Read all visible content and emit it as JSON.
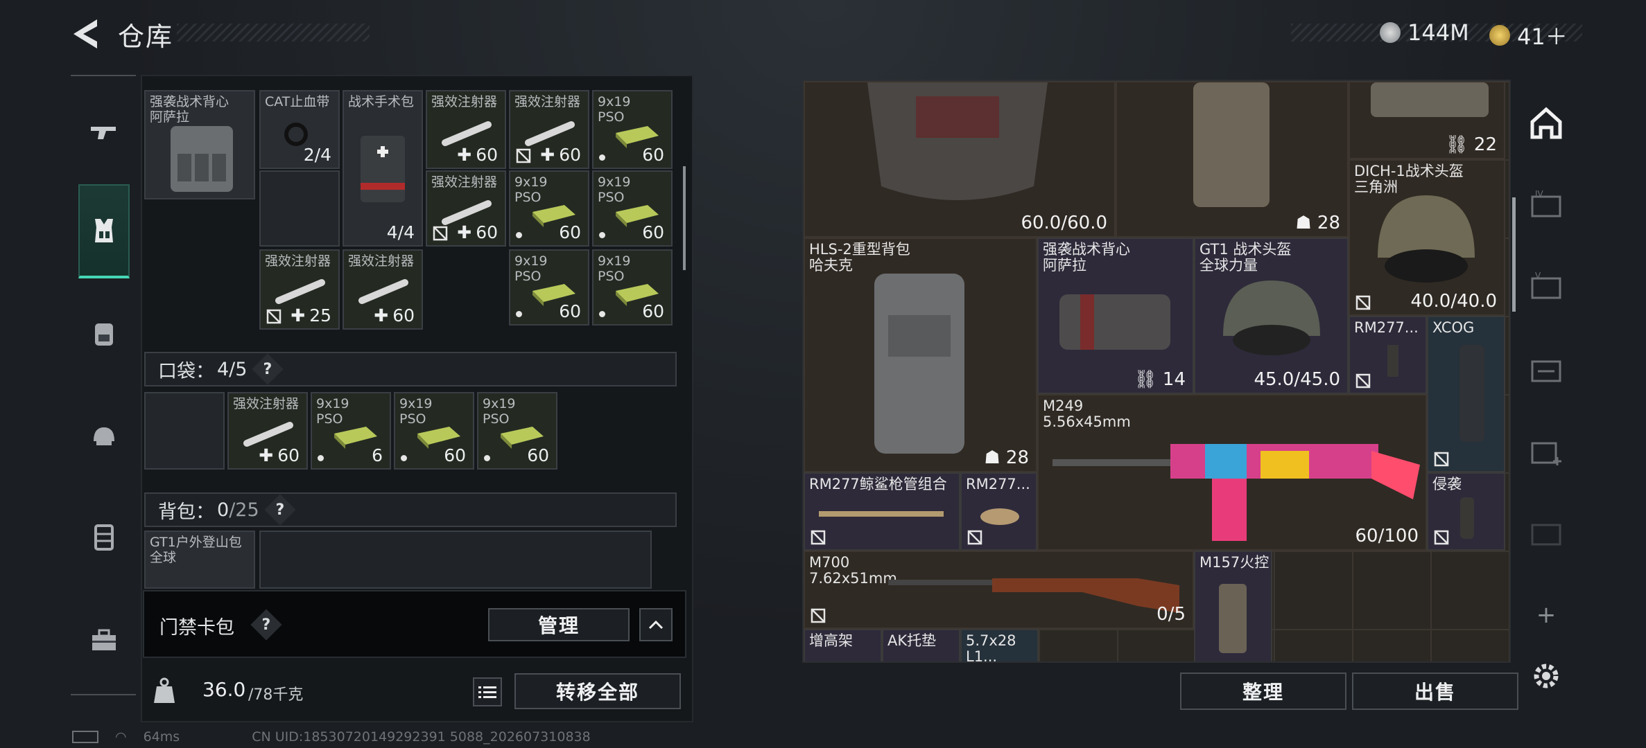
{
  "header": {
    "title": "仓库"
  },
  "currency": {
    "silver": {
      "value": "144M",
      "icon": "silver-coin-icon"
    },
    "gold": {
      "value": "41＋",
      "icon": "gold-coin-icon"
    }
  },
  "left_nav": [
    "weapon-icon",
    "equipment-icon",
    "backpack-icon",
    "helmet-icon",
    "chest-rig-icon",
    "toolbox-icon"
  ],
  "vest_grid": {
    "vest": {
      "label": "强袭战术背心\n阿萨拉"
    },
    "items": [
      {
        "label": "CAT止血带",
        "count": "2/4"
      },
      {
        "label": "战术手术包",
        "count": "4/4"
      },
      {
        "label": "强效注射器",
        "count": "60"
      },
      {
        "label": "强效注射器",
        "count": "60"
      },
      {
        "label": "9x19\nPSO",
        "count": "60"
      },
      {
        "label": "强效注射器",
        "count": "60"
      },
      {
        "label": "9x19\nPSO",
        "count": "60"
      },
      {
        "label": "9x19\nPSO",
        "count": "60"
      },
      {
        "label": "强效注射器",
        "count": "25"
      },
      {
        "label": "强效注射器",
        "count": "60"
      },
      {
        "label": "9x19\nPSO",
        "count": "60"
      },
      {
        "label": "9x19\nPSO",
        "count": "60"
      }
    ]
  },
  "pocket": {
    "label": "口袋：",
    "value": "4/5",
    "help": "?",
    "items": [
      {
        "label": "强效注射器",
        "count": "60"
      },
      {
        "label": "9x19\nPSO",
        "count": "6"
      },
      {
        "label": "9x19\nPSO",
        "count": "60"
      },
      {
        "label": "9x19\nPSO",
        "count": "60"
      }
    ]
  },
  "backpack": {
    "label": "背包：",
    "value_main": "0",
    "value_cap": "/25",
    "help": "?",
    "item_label": "GT1户外登山包\n全球"
  },
  "keycase": {
    "label": "门禁卡包",
    "help": "?",
    "manage": "管理"
  },
  "weight": {
    "current": "36.0",
    "max": "/78千克",
    "transfer_all": "转移全部"
  },
  "stash": {
    "items": [
      {
        "label": "",
        "count": "60.0/60.0"
      },
      {
        "label": "",
        "count": "28"
      },
      {
        "label": "",
        "count": "22"
      },
      {
        "label": "DICH-1战术头盔\n三角洲",
        "count": "40.0/40.0"
      },
      {
        "label": "HLS-2重型背包\n哈夫克",
        "count": "28"
      },
      {
        "label": "强袭战术背心\n阿萨拉",
        "count": "14"
      },
      {
        "label": "GT1 战术头盔\n全球力量",
        "count": "45.0/45.0"
      },
      {
        "label": "RM277...",
        "count": ""
      },
      {
        "label": "XCOG",
        "count": ""
      },
      {
        "label": "M249\n5.56x45mm",
        "count": "60/100"
      },
      {
        "label": "RM277鲸鲨枪管组合",
        "count": ""
      },
      {
        "label": "RM277...",
        "count": ""
      },
      {
        "label": "侵袭",
        "count": ""
      },
      {
        "label": "M700\n7.62x51mm",
        "count": "0/5"
      },
      {
        "label": "M157火控",
        "count": ""
      },
      {
        "label": "增高架",
        "count": ""
      },
      {
        "label": "AK托垫",
        "count": ""
      },
      {
        "label": "5.7x28\nL1...",
        "count": ""
      }
    ],
    "sort": "整理",
    "sell": "出售"
  },
  "status": {
    "ping": "64ms",
    "uid": "CN UID:18530720149292391 5088_202607310838"
  }
}
